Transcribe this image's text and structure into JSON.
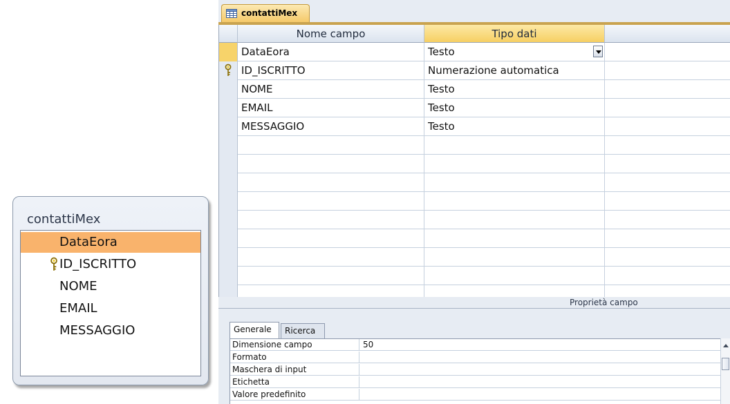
{
  "field_list": {
    "title": "contattiMex",
    "items": [
      {
        "label": "DataEora",
        "selected": true,
        "key": false
      },
      {
        "label": "ID_ISCRITTO",
        "selected": false,
        "key": true
      },
      {
        "label": "NOME",
        "selected": false,
        "key": false
      },
      {
        "label": "EMAIL",
        "selected": false,
        "key": false
      },
      {
        "label": "MESSAGGIO",
        "selected": false,
        "key": false
      }
    ]
  },
  "design": {
    "tab_label": "contattiMex",
    "columns": {
      "name": "Nome campo",
      "type": "Tipo dati"
    },
    "rows": [
      {
        "name": "DataEora",
        "type": "Testo",
        "current": true,
        "key": false
      },
      {
        "name": "ID_ISCRITTO",
        "type": "Numerazione automatica",
        "current": false,
        "key": true
      },
      {
        "name": "NOME",
        "type": "Testo",
        "current": false,
        "key": false
      },
      {
        "name": "EMAIL",
        "type": "Testo",
        "current": false,
        "key": false
      },
      {
        "name": "MESSAGGIO",
        "type": "Testo",
        "current": false,
        "key": false
      }
    ],
    "empty_rows": 9
  },
  "properties": {
    "title": "Proprietà campo",
    "tabs": [
      {
        "label": "Generale",
        "active": true
      },
      {
        "label": "Ricerca",
        "active": false
      }
    ],
    "rows": [
      {
        "label": "Dimensione campo",
        "value": "50"
      },
      {
        "label": "Formato",
        "value": ""
      },
      {
        "label": "Maschera di input",
        "value": ""
      },
      {
        "label": "Etichetta",
        "value": ""
      },
      {
        "label": "Valore predefinito",
        "value": ""
      }
    ]
  },
  "colors": {
    "selection": "#f9b36c",
    "tab": "#f5c96a",
    "header_selected": "#f6cf63"
  },
  "icons": [
    "table-icon",
    "primary-key-icon",
    "dropdown-arrow-icon",
    "scroll-up-icon"
  ]
}
